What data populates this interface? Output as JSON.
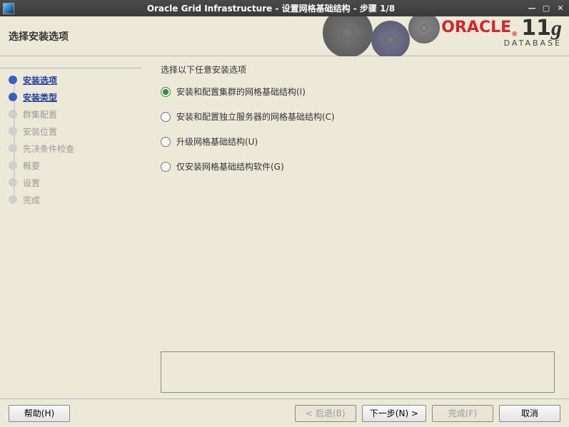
{
  "window": {
    "title": "Oracle Grid Infrastructure - 设置网格基础结构 - 步骤 1/8"
  },
  "header": {
    "page_title": "选择安装选项",
    "logo_brand": "ORACLE",
    "logo_product": "DATABASE",
    "logo_version_num": "11",
    "logo_version_sfx": "g"
  },
  "sidebar": {
    "items": [
      {
        "label": "安装选项",
        "state": "done"
      },
      {
        "label": "安装类型",
        "state": "active"
      },
      {
        "label": "群集配置",
        "state": "future"
      },
      {
        "label": "安装位置",
        "state": "future"
      },
      {
        "label": "先决条件检查",
        "state": "future"
      },
      {
        "label": "概要",
        "state": "future"
      },
      {
        "label": "设置",
        "state": "future"
      },
      {
        "label": "完成",
        "state": "future"
      }
    ]
  },
  "content": {
    "prompt": "选择以下任意安装选项",
    "options": [
      {
        "label": "安装和配置集群的网格基础结构(I)",
        "value": "cluster",
        "selected": true
      },
      {
        "label": "安装和配置独立服务器的网格基础结构(C)",
        "value": "standalone",
        "selected": false
      },
      {
        "label": "升级网格基础结构(U)",
        "value": "upgrade",
        "selected": false
      },
      {
        "label": "仅安装网格基础结构软件(G)",
        "value": "software_only",
        "selected": false
      }
    ]
  },
  "footer": {
    "help": "帮助(H)",
    "back": "< 后退(B)",
    "next": "下一步(N) >",
    "finish": "完成(F)",
    "cancel": "取消"
  }
}
